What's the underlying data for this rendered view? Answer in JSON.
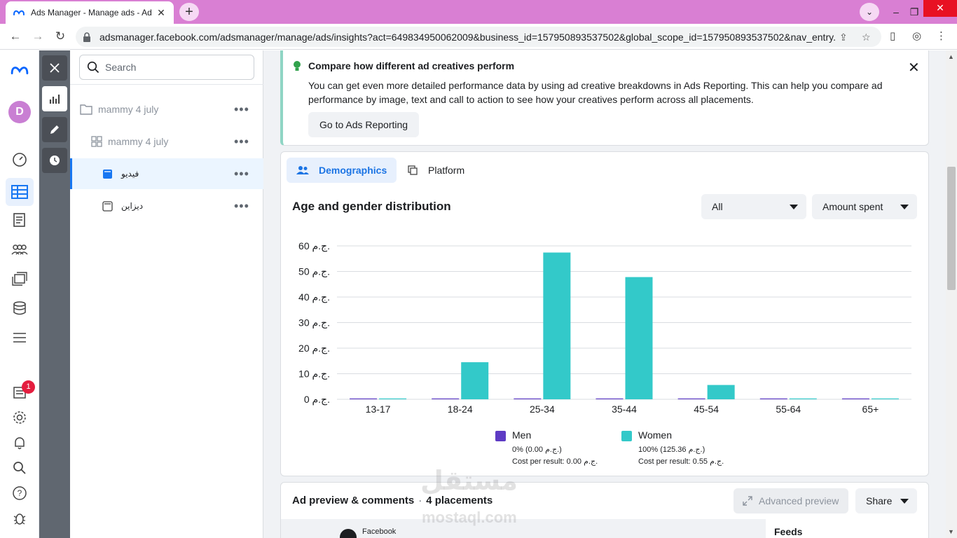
{
  "browser": {
    "tab_title": "Ads Manager - Manage ads - Ad",
    "url": "adsmanager.facebook.com/adsmanager/manage/ads/insights?act=649834950062009&business_id=157950893537502&global_scope_id=157950893537502&nav_entry..."
  },
  "rail": {
    "avatar_letter": "D",
    "notification_count": "1"
  },
  "tree": {
    "search_placeholder": "Search",
    "items": [
      {
        "label": "mammy 4 july"
      },
      {
        "label": "mammy 4 july"
      },
      {
        "label": "فيديو"
      },
      {
        "label": "ديزاين"
      }
    ]
  },
  "tip": {
    "title": "Compare how different ad creatives perform",
    "body": "You can get even more detailed performance data by using ad creative breakdowns in Ads Reporting. This can help you compare ad performance by image, text and call to action to see how your creatives perform across all placements.",
    "button": "Go to Ads Reporting"
  },
  "breakdown": {
    "tabs": [
      {
        "label": "Demographics"
      },
      {
        "label": "Platform"
      }
    ],
    "title": "Age and gender distribution",
    "filter_value": "All",
    "metric_value": "Amount spent"
  },
  "chart_data": {
    "type": "bar",
    "title": "Age and gender distribution",
    "categories": [
      "13-17",
      "18-24",
      "25-34",
      "35-44",
      "45-54",
      "55-64",
      "65+"
    ],
    "series": [
      {
        "name": "Men",
        "values": [
          0,
          0,
          0,
          0,
          0,
          0,
          0
        ],
        "color": "#5e3bc4"
      },
      {
        "name": "Women",
        "values": [
          0,
          14.5,
          57.4,
          47.8,
          5.6,
          0,
          0
        ],
        "color": "#33c9c9"
      }
    ],
    "y_ticks": [
      "0 ج.م.",
      "10 ج.م.",
      "20 ج.م.",
      "30 ج.م.",
      "40 ج.م.",
      "50 ج.م.",
      "60 ج.م."
    ],
    "ylim": [
      0,
      60
    ],
    "grid": true,
    "legend_position": "bottom",
    "legend": [
      {
        "name": "Men",
        "share": "0% (0.00 ج.م.)",
        "cost": "Cost per result: 0.00 ج.م."
      },
      {
        "name": "Women",
        "share": "100% (125.36 ج.م.)",
        "cost": "Cost per result: 0.55 ج.م."
      }
    ]
  },
  "preview": {
    "title": "Ad preview & comments",
    "placements": "4 placements",
    "advanced_button": "Advanced preview",
    "share_button": "Share",
    "platform": "Facebook",
    "feeds_label": "Feeds"
  },
  "watermark": {
    "text": "مستقل",
    "domain": "mostaql.com"
  },
  "colors": {
    "accent": "#1877f2",
    "titlebar": "#d97fd3",
    "women": "#33c9c9",
    "men": "#5e3bc4"
  }
}
